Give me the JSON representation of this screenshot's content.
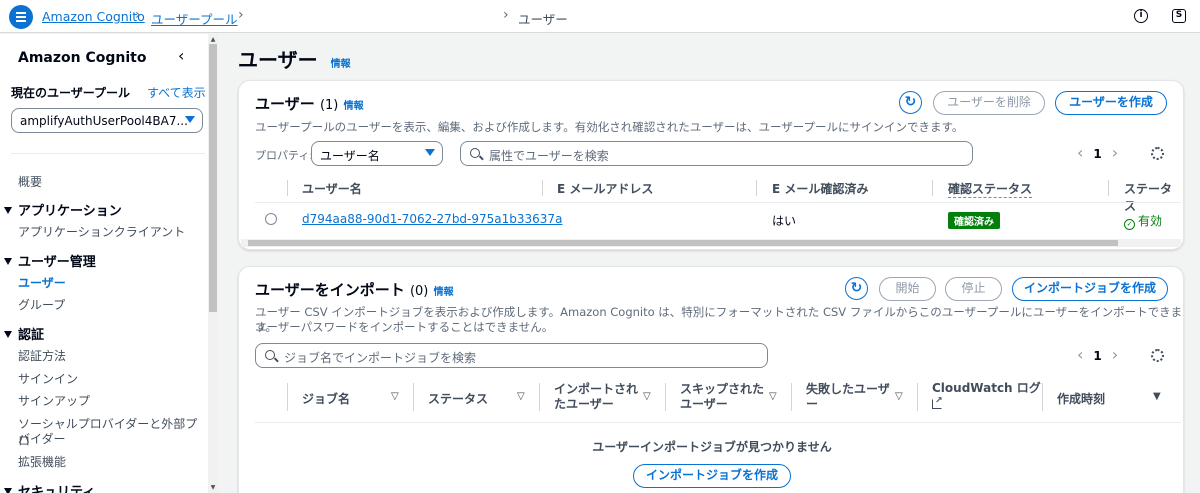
{
  "breadcrumb": {
    "root": "Amazon Cognito",
    "pools": "ユーザープール",
    "current": "ユーザー"
  },
  "topbar": {
    "info_icon": "i",
    "settings_icon": "S"
  },
  "sidebar": {
    "title": "Amazon Cognito",
    "current_pool_label": "現在のユーザープール",
    "show_all": "すべて表示",
    "pool_select_value": "amplifyAuthUserPool4BA7...",
    "items": {
      "overview": "概要",
      "applications": "アプリケーション",
      "app_clients": "アプリケーションクライアント",
      "user_management": "ユーザー管理",
      "users": "ユーザー",
      "groups": "グループ",
      "auth": "認証",
      "auth_methods": "認証方法",
      "sign_in": "サインイン",
      "sign_up": "サインアップ",
      "social_idp_1": "ソーシャルプロバイダーと外部プロ",
      "social_idp_2": "バイダー",
      "extensions": "拡張機能",
      "security": "セキュリティ"
    }
  },
  "page": {
    "title": "ユーザー",
    "info": "情報"
  },
  "users_panel": {
    "title": "ユーザー",
    "count": "(1)",
    "info": "情報",
    "description": "ユーザープールのユーザーを表示、編集、および作成します。有効化され確認されたユーザーは、ユーザープールにサインインできます。",
    "delete_button": "ユーザーを削除",
    "create_button": "ユーザーを作成",
    "property_label": "プロパティ:",
    "property_value": "ユーザー名",
    "search_placeholder": "属性でユーザーを検索",
    "page_number": "1",
    "columns": {
      "username": "ユーザー名",
      "email": "E メールアドレス",
      "email_verified": "E メール確認済み",
      "confirmation": "確認ステータス",
      "status": "ステータス"
    },
    "rows": [
      {
        "username": "d794aa88-90d1-7062-27bd-975a1b33637a",
        "email": "",
        "email_verified": "はい",
        "confirmation": "確認済み",
        "status": "有効"
      }
    ]
  },
  "import_panel": {
    "title": "ユーザーをインポート",
    "count": "(0)",
    "info": "情報",
    "description_1": "ユーザー CSV インポートジョブを表示および作成します。Amazon Cognito は、特別にフォーマットされた CSV ファイルからこのユーザープールにユーザーをインポートできます。",
    "description_2": "ユーザーパスワードをインポートすることはできません。",
    "start_button": "開始",
    "stop_button": "停止",
    "create_job_button": "インポートジョブを作成",
    "search_placeholder": "ジョブ名でインポートジョブを検索",
    "page_number": "1",
    "columns": {
      "job_name": "ジョブ名",
      "status": "ステータス",
      "imported_1": "インポートされ",
      "imported_2": "たユーザー",
      "skipped_1": "スキップされた",
      "skipped_2": "ユーザー",
      "failed_1": "失敗したユーザ",
      "failed_2": "ー",
      "cloudwatch": "CloudWatch ログ",
      "created": "作成時刻"
    },
    "empty_message": "ユーザーインポートジョブが見つかりません",
    "empty_create_button": "インポートジョブを作成"
  },
  "colors": {
    "accent": "#0972d3",
    "success": "#037f0c",
    "text": "#000716"
  }
}
